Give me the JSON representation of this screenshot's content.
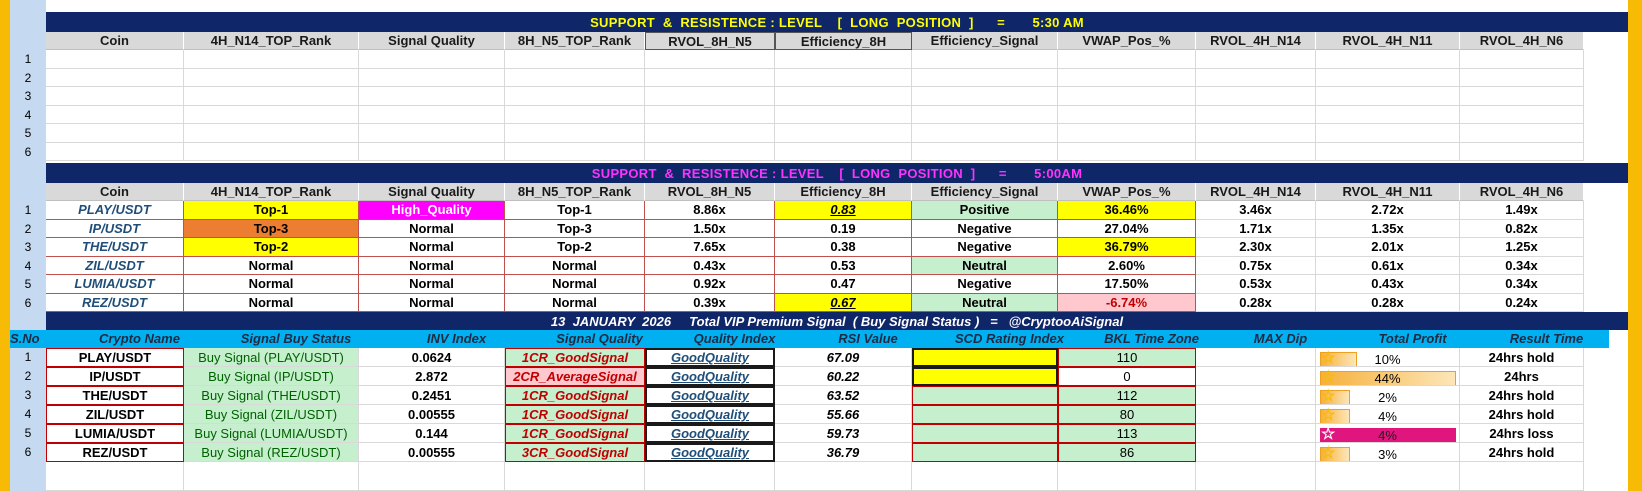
{
  "banner1": {
    "title": "SUPPORT  &  RESISTENCE : LEVEL    [  LONG  POSITION  ]",
    "eq": "=",
    "time": "5:30 AM"
  },
  "banner2": {
    "title": "SUPPORT  &  RESISTENCE : LEVEL    [  LONG  POSITION  ]",
    "eq": "=",
    "time": "5:00AM"
  },
  "columns": [
    "Coin",
    "4H_N14_TOP_Rank",
    "Signal Quality",
    "8H_N5_TOP_Rank",
    "RVOL_8H_N5",
    "Efficiency_8H",
    "Efficiency_Signal",
    "VWAP_Pos_%",
    "RVOL_4H_N14",
    "RVOL_4H_N11",
    "RVOL_4H_N6"
  ],
  "row_numbers": [
    "1",
    "2",
    "3",
    "4",
    "5",
    "6"
  ],
  "table2": [
    [
      "PLAY/USDT",
      "Top-1",
      "High_Quality",
      "Top-1",
      "8.86x",
      "0.83",
      "Positive",
      "36.46%",
      "3.46x",
      "2.72x",
      "1.49x"
    ],
    [
      "IP/USDT",
      "Top-3",
      "Normal",
      "Top-3",
      "1.50x",
      "0.19",
      "Negative",
      "27.04%",
      "1.71x",
      "1.35x",
      "0.82x"
    ],
    [
      "THE/USDT",
      "Top-2",
      "Normal",
      "Top-2",
      "7.65x",
      "0.38",
      "Negative",
      "36.79%",
      "2.30x",
      "2.01x",
      "1.25x"
    ],
    [
      "ZIL/USDT",
      "Normal",
      "Normal",
      "Normal",
      "0.43x",
      "0.53",
      "Neutral",
      "2.60%",
      "0.75x",
      "0.61x",
      "0.34x"
    ],
    [
      "LUMIA/USDT",
      "Normal",
      "Normal",
      "Normal",
      "0.92x",
      "0.47",
      "Negative",
      "17.50%",
      "0.53x",
      "0.43x",
      "0.34x"
    ],
    [
      "REZ/USDT",
      "Normal",
      "Normal",
      "Normal",
      "0.39x",
      "0.67",
      "Neutral",
      "-6.74%",
      "0.28x",
      "0.28x",
      "0.24x"
    ]
  ],
  "vip": {
    "date": "13  JANUARY  2026",
    "title": "Total VIP Premium Signal  ( Buy Signal Status )",
    "eq": "=",
    "handle": "@CryptooAiSignal"
  },
  "table3_headers": [
    "S.No",
    "Crypto Name",
    "Signal Buy Status",
    "INV  Index",
    "Signal Quality",
    "Quality Index",
    "RSI Value",
    "SCD  Rating Index",
    "BKL Time Zone",
    "MAX Dip",
    "Total Profit",
    "Result Time"
  ],
  "table3": [
    {
      "sno": "1",
      "name": "PLAY/USDT",
      "status": "Buy Signal (PLAY/USDT)",
      "inv": "0.0624",
      "quality": "1CR_GoodSignal",
      "qindex": "GoodQuality",
      "rsi": "67.09",
      "scd": "",
      "bkl": "110",
      "dip": "",
      "profit": "10%",
      "profit_fill": 0.27,
      "result": "24hrs hold"
    },
    {
      "sno": "2",
      "name": "IP/USDT",
      "status": "Buy Signal (IP/USDT)",
      "inv": "2.872",
      "quality": "2CR_AverageSignal",
      "qindex": "GoodQuality",
      "rsi": "60.22",
      "scd": "",
      "bkl": "0",
      "dip": "",
      "profit": "44%",
      "profit_fill": 1.0,
      "result": "24hrs"
    },
    {
      "sno": "3",
      "name": "THE/USDT",
      "status": "Buy Signal (THE/USDT)",
      "inv": "0.2451",
      "quality": "1CR_GoodSignal",
      "qindex": "GoodQuality",
      "rsi": "63.52",
      "scd": "",
      "bkl": "112",
      "dip": "",
      "profit": "2%",
      "profit_fill": 0.05,
      "result": "24hrs hold"
    },
    {
      "sno": "4",
      "name": "ZIL/USDT",
      "status": "Buy Signal (ZIL/USDT)",
      "inv": "0.00555",
      "quality": "1CR_GoodSignal",
      "qindex": "GoodQuality",
      "rsi": "55.66",
      "scd": "",
      "bkl": "80",
      "dip": "",
      "profit": "4%",
      "profit_fill": 0.09,
      "result": "24hrs hold"
    },
    {
      "sno": "5",
      "name": "LUMIA/USDT",
      "status": "Buy Signal (LUMIA/USDT)",
      "inv": "0.144",
      "quality": "1CR_GoodSignal",
      "qindex": "GoodQuality",
      "rsi": "59.73",
      "scd": "",
      "bkl": "113",
      "dip": "",
      "profit": "4%",
      "profit_fill": 1.0,
      "result": "24hrs loss"
    },
    {
      "sno": "6",
      "name": "REZ/USDT",
      "status": "Buy Signal (REZ/USDT)",
      "inv": "0.00555",
      "quality": "3CR_GoodSignal",
      "qindex": "GoodQuality",
      "rsi": "36.79",
      "scd": "",
      "bkl": "86",
      "dip": "",
      "profit": "3%",
      "profit_fill": 0.07,
      "result": "24hrs hold"
    }
  ],
  "colors": {
    "navy": "#0f2669",
    "banner1_text": "#ffff00",
    "banner2_text": "#ff33ff",
    "header_cyan": "#00b0f0",
    "yellow": "#ffff00",
    "magenta": "#ff00ff",
    "orange": "#ed7d31",
    "green": "#c6efce",
    "pink": "#ffc7ce",
    "side_border": "#f7bb06",
    "loss_bar": "#e0157d"
  }
}
